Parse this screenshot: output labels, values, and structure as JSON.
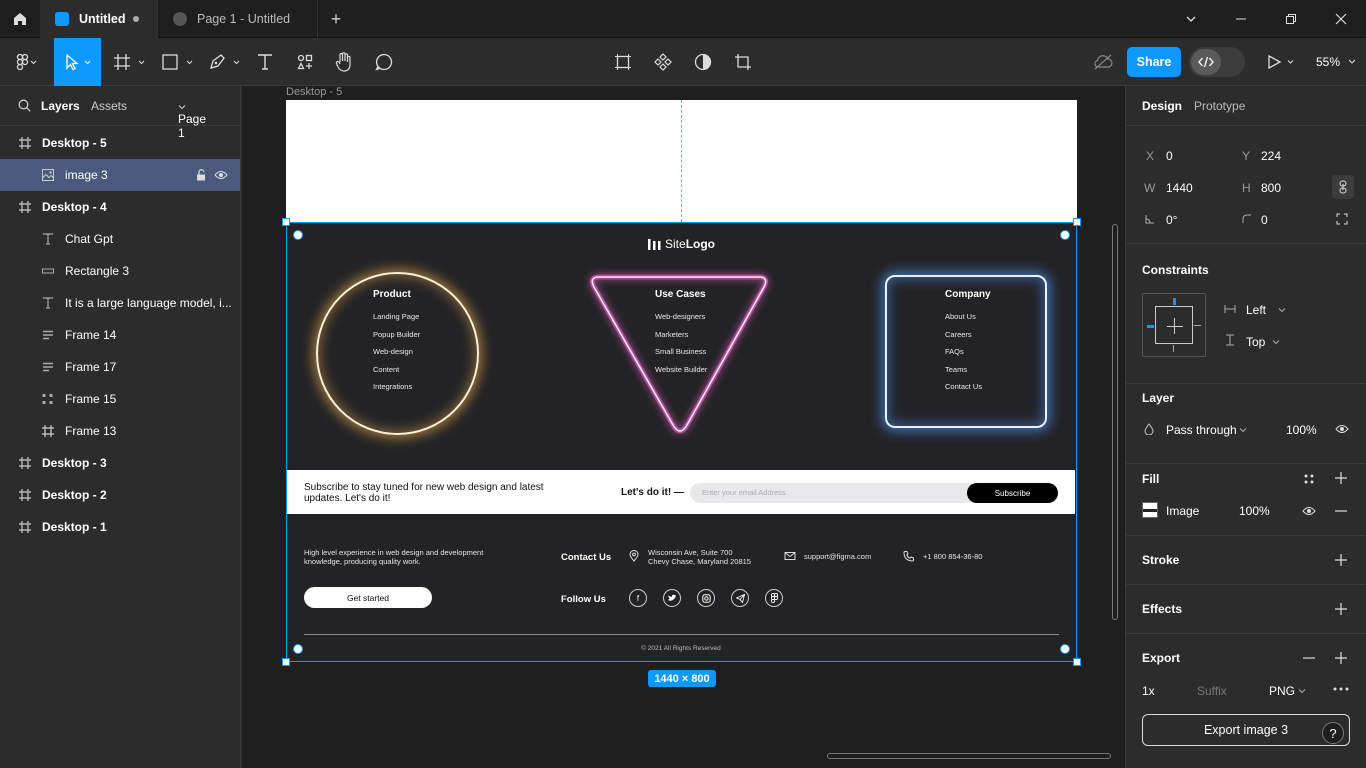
{
  "titlebar": {
    "tabs": [
      {
        "label": "Untitled"
      },
      {
        "label": "Page 1 - Untitled"
      }
    ],
    "colors": {
      "figma_blue": "#0d99ff"
    }
  },
  "toolbar": {
    "share_label": "Share",
    "zoom_label": "55%"
  },
  "left_panel": {
    "tab_layers": "Layers",
    "tab_assets": "Assets",
    "page_selector": "Page 1",
    "layers": [
      {
        "name": "Desktop - 5",
        "icon": "frame-icon"
      },
      {
        "name": "image 3",
        "icon": "image-icon"
      },
      {
        "name": "Desktop - 4",
        "icon": "frame-icon"
      },
      {
        "name": "Chat Gpt",
        "icon": "text-icon"
      },
      {
        "name": "Rectangle 3",
        "icon": "rectangle-icon"
      },
      {
        "name": "It is a large language model, i...",
        "icon": "text-icon"
      },
      {
        "name": "Frame 14",
        "icon": "autolayout-icon"
      },
      {
        "name": "Frame 17",
        "icon": "autolayout-icon"
      },
      {
        "name": "Frame 15",
        "icon": "grid-icon"
      },
      {
        "name": "Frame 13",
        "icon": "frame-icon"
      },
      {
        "name": "Desktop - 3",
        "icon": "frame-icon"
      },
      {
        "name": "Desktop - 2",
        "icon": "frame-icon"
      },
      {
        "name": "Desktop - 1",
        "icon": "frame-icon"
      }
    ]
  },
  "canvas": {
    "frame_label": "Desktop - 5",
    "dimension_badge": "1440 × 800",
    "footer": {
      "logo_light": "Site",
      "logo_bold": "Logo",
      "columns": [
        {
          "heading": "Product",
          "links": [
            "Landing Page",
            "Popup Builder",
            "Web-design",
            "Content",
            "Integrations"
          ]
        },
        {
          "heading": "Use Cases",
          "links": [
            "Web-designers",
            "Marketers",
            "Small Business",
            "Website Builder"
          ]
        },
        {
          "heading": "Company",
          "links": [
            "About Us",
            "Careers",
            "FAQs",
            "Teams",
            "Contact Us"
          ]
        }
      ],
      "subscribe": {
        "text": "Subscribe to stay tuned for new web design and latest updates. Let's do it!",
        "cta": "Let's do it! —",
        "placeholder": "Enter your email Address",
        "button": "Subscribe"
      },
      "description": "High level experience in web design and development knowledge, producing quality work.",
      "get_started": "Get started",
      "contact_label": "Contact Us",
      "address_line1": "Wisconsin Ave, Suite 700",
      "address_line2": "Chevy Chase, Maryland 20815",
      "email": "support@figma.com",
      "phone": "+1 800 854-36-80",
      "follow_label": "Follow Us",
      "social_icons": [
        "facebook-icon",
        "twitter-icon",
        "instagram-icon",
        "telegram-icon",
        "figma-icon"
      ],
      "copyright": "© 2021 All Rights Reserved",
      "colors": {
        "bg": "#232326",
        "circle_glow": "#f5b450",
        "triangle_glow": "#e060c0",
        "rect_glow": "#5096ff"
      }
    }
  },
  "right_panel": {
    "tab_design": "Design",
    "tab_prototype": "Prototype",
    "x_label": "X",
    "x_value": "0",
    "y_label": "Y",
    "y_value": "224",
    "w_label": "W",
    "w_value": "1440",
    "h_label": "H",
    "h_value": "800",
    "rotation": "0°",
    "radius": "0",
    "constraints_title": "Constraints",
    "constraint_h": "Left",
    "constraint_v": "Top",
    "layer_title": "Layer",
    "blend_mode": "Pass through",
    "layer_opacity": "100%",
    "fill_title": "Fill",
    "fill_type": "Image",
    "fill_opacity": "100%",
    "stroke_title": "Stroke",
    "effects_title": "Effects",
    "export_title": "Export",
    "export_scale": "1x",
    "export_suffix_placeholder": "Suffix",
    "export_format": "PNG",
    "export_button": "Export image 3",
    "help": "?"
  }
}
